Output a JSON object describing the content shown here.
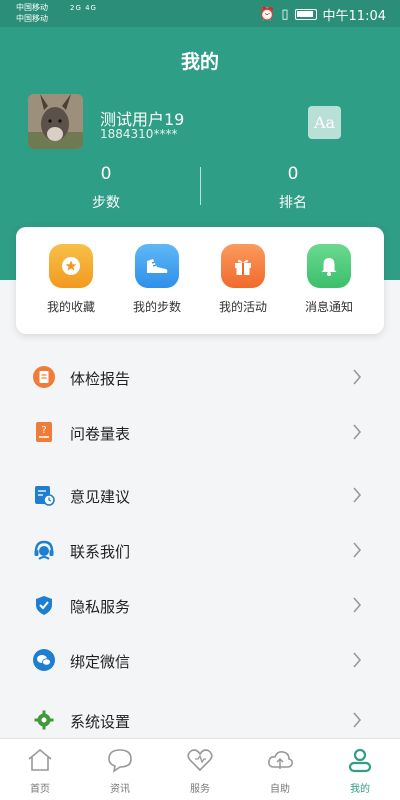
{
  "status_bar": {
    "carrier_1": "中国移动",
    "carrier_2": "中国移动",
    "network": "2G 4G",
    "time": "中午11:04"
  },
  "header": {
    "title": "我的"
  },
  "user": {
    "name": "测试用户19",
    "phone": "1884310****",
    "font_button_label": "Aa"
  },
  "stats": [
    {
      "value": "0",
      "label": "步数"
    },
    {
      "value": "0",
      "label": "排名"
    }
  ],
  "quick_actions": [
    {
      "label": "我的收藏",
      "icon": "star-icon",
      "color": "#f5a623"
    },
    {
      "label": "我的步数",
      "icon": "shoe-icon",
      "color": "#3aa0f0"
    },
    {
      "label": "我的活动",
      "icon": "gift-icon",
      "color": "#f57a3c"
    },
    {
      "label": "消息通知",
      "icon": "bell-icon",
      "color": "#48c878"
    }
  ],
  "menu": [
    {
      "label": "体检报告",
      "icon": "report-icon"
    },
    {
      "label": "问卷量表",
      "icon": "questionnaire-icon"
    },
    {
      "label": "意见建议",
      "icon": "feedback-icon"
    },
    {
      "label": "联系我们",
      "icon": "headset-icon"
    },
    {
      "label": "隐私服务",
      "icon": "shield-icon"
    },
    {
      "label": "绑定微信",
      "icon": "wechat-icon"
    },
    {
      "label": "系统设置",
      "icon": "gear-icon"
    }
  ],
  "tabs": [
    {
      "label": "首页",
      "icon": "home-icon"
    },
    {
      "label": "资讯",
      "icon": "chat-icon"
    },
    {
      "label": "服务",
      "icon": "heart-icon"
    },
    {
      "label": "自助",
      "icon": "cloud-icon"
    },
    {
      "label": "我的",
      "icon": "person-icon",
      "active": true
    }
  ],
  "colors": {
    "accent": "#2f9e86",
    "menu_icon_orange": "#f07c3a",
    "menu_icon_blue": "#1e7fd1",
    "menu_icon_green": "#3f9a3a"
  }
}
